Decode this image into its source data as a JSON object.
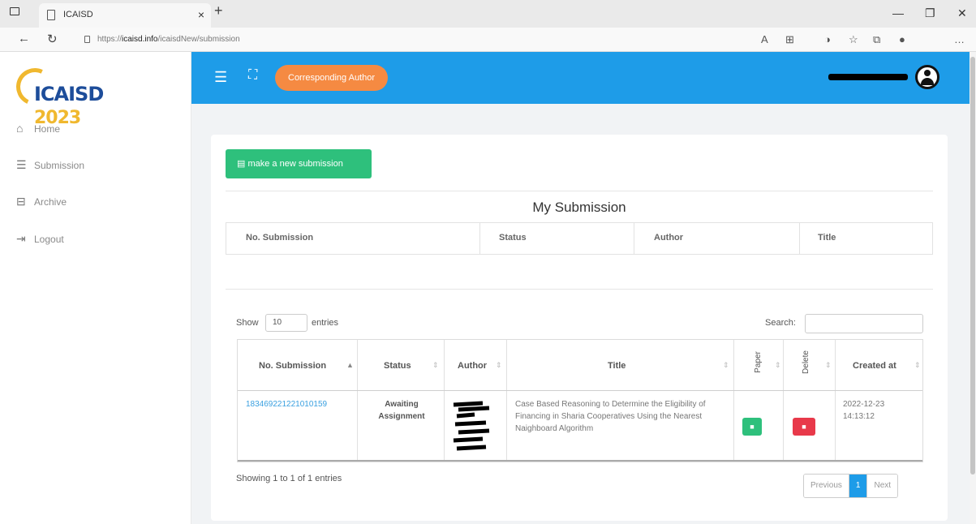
{
  "browser": {
    "tab_title": "ICAISD",
    "tab_close": "×",
    "new_tab": "+",
    "url_prefix": "https://",
    "url_host": "icaisd.info",
    "url_path": "/icaisdNew/submission"
  },
  "sidebar": {
    "logo_text": "ICAISD",
    "logo_year": "2023",
    "items": [
      {
        "label": "Home",
        "icon": "home-icon"
      },
      {
        "label": "Submission",
        "icon": "list-icon"
      },
      {
        "label": "Archive",
        "icon": "inbox-icon"
      },
      {
        "label": "Logout",
        "icon": "logout-icon"
      }
    ]
  },
  "header": {
    "role_label": "Corresponding Author",
    "accent_color": "#1e9ce8"
  },
  "main": {
    "new_submission_label": "make a new submission",
    "my_submission_title": "My Submission",
    "summary_columns": [
      "No. Submission",
      "Status",
      "Author",
      "Title"
    ],
    "show_label": "Show",
    "entries_value": "10",
    "entries_label": "entries",
    "search_label": "Search:",
    "columns": [
      "No. Submission",
      "Status",
      "Author",
      "Title",
      "Paper",
      "Delete",
      "Created at"
    ],
    "rows": [
      {
        "id": "183469221221010159",
        "status": "Awaiting Assignment",
        "title": "Case Based Reasoning to Determine the Eligibility of Financing in Sharia Cooperatives Using the Nearest Naighboard Algorithm",
        "paper_btn": "■",
        "delete_btn": "■",
        "created_at": "2022-12-23 14:13:12"
      }
    ],
    "info": "Showing 1 to 1 of 1 entries",
    "pagination": {
      "prev": "Previous",
      "current": "1",
      "next": "Next"
    }
  }
}
